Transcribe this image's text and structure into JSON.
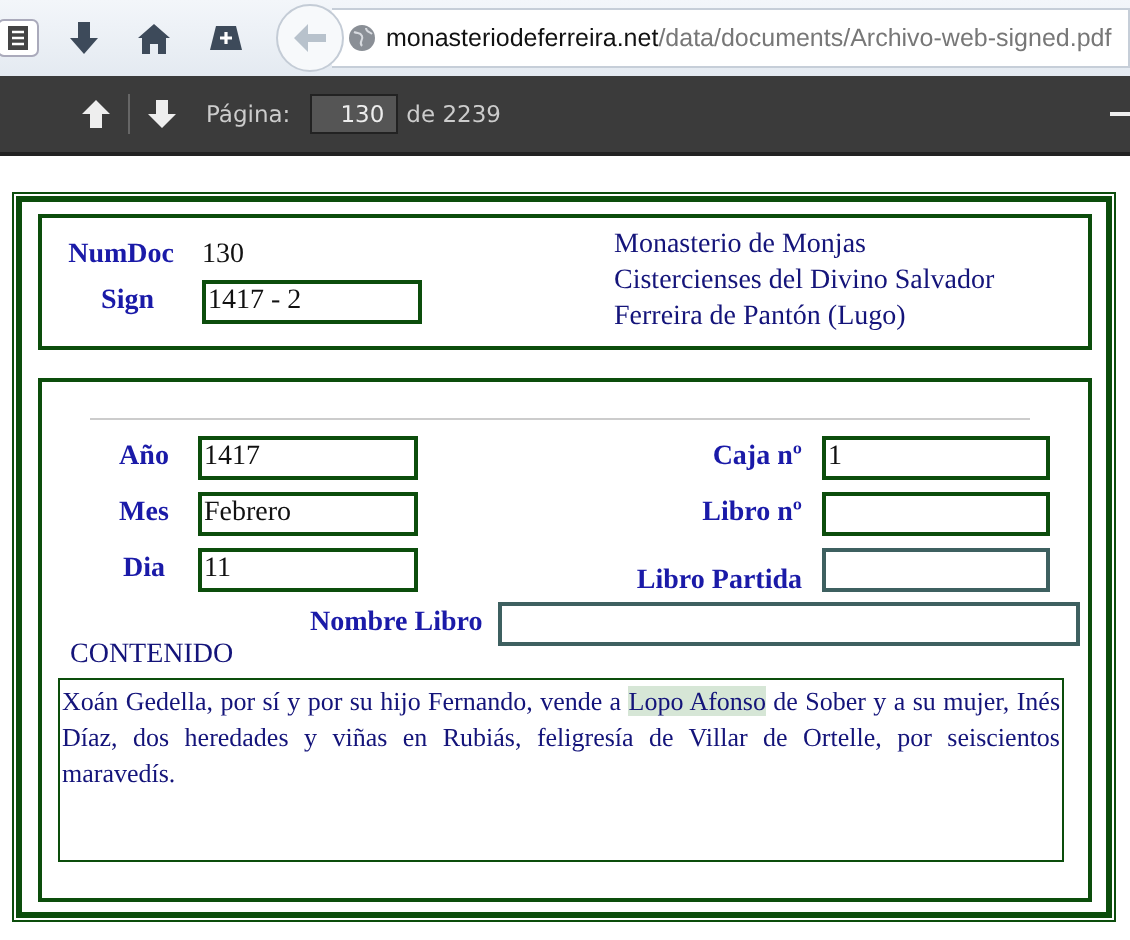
{
  "browser": {
    "url_domain": "monasteriodeferreira.net",
    "url_path": "/data/documents/Archivo-web-signed.pdf"
  },
  "pdf_toolbar": {
    "page_label": "Página:",
    "page_value": "130",
    "page_total": "de 2239"
  },
  "header": {
    "numdoc_label": "NumDoc",
    "numdoc_value": "130",
    "sign_label": "Sign",
    "sign_value": "1417 - 2",
    "institution": [
      "Monasterio de Monjas",
      "Cistercienses del Divino Salvador",
      "Ferreira de Pantón (Lugo)"
    ]
  },
  "left_fields": [
    {
      "label": "Año",
      "value": "1417"
    },
    {
      "label": "Mes",
      "value": "Febrero"
    },
    {
      "label": "Dia",
      "value": "11"
    }
  ],
  "right_fields": [
    {
      "label": "Caja nº",
      "value": "1"
    },
    {
      "label": "Libro nº"
    },
    {
      "label": "Libro Partida"
    }
  ],
  "nombre_libro": {
    "label": "Nombre Libro"
  },
  "contenido": {
    "label": "CONTENIDO",
    "text_before": "Xoán Gedella, por sí y por su hijo Fernando, vende a ",
    "highlight": "Lopo Afonso",
    "text_after": " de Sober y a su mujer, Inés Díaz, dos heredades y viñas en Rubiás, feligresía de Villar de Ortelle, por seiscientos maravedís."
  }
}
